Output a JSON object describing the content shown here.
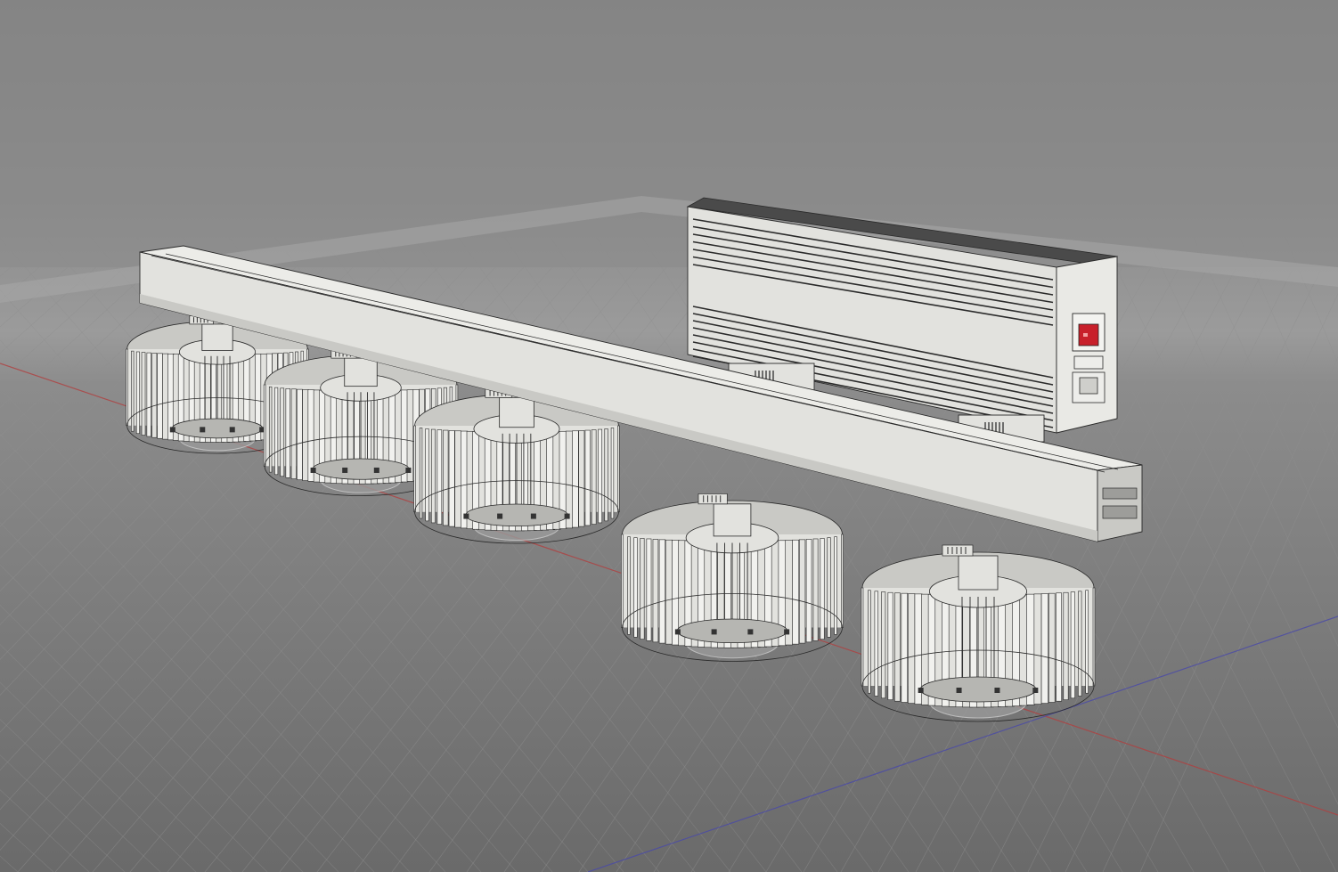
{
  "viewport": {
    "type": "3d-cad-viewport",
    "background": {
      "top": "#7d7d7d",
      "horizon": "#9b9b9b",
      "bottom": "#666666"
    },
    "grid": {
      "visible": true,
      "line_color": "#8f8f8f",
      "major_color": "#a8a8a8"
    },
    "axes": {
      "x_color": "#b04040",
      "y_color": "#4a4aa8"
    }
  },
  "model": {
    "description_icons": [
      "heatsink-fixture",
      "aluminium-rail",
      "driver-box"
    ],
    "fixture_count": 5,
    "colors": {
      "body": "#e2e2de",
      "shade": "#c9c9c5",
      "dark": "#b6b6b2",
      "edge": "#2a2a2a",
      "switch": "#c8202a"
    }
  }
}
